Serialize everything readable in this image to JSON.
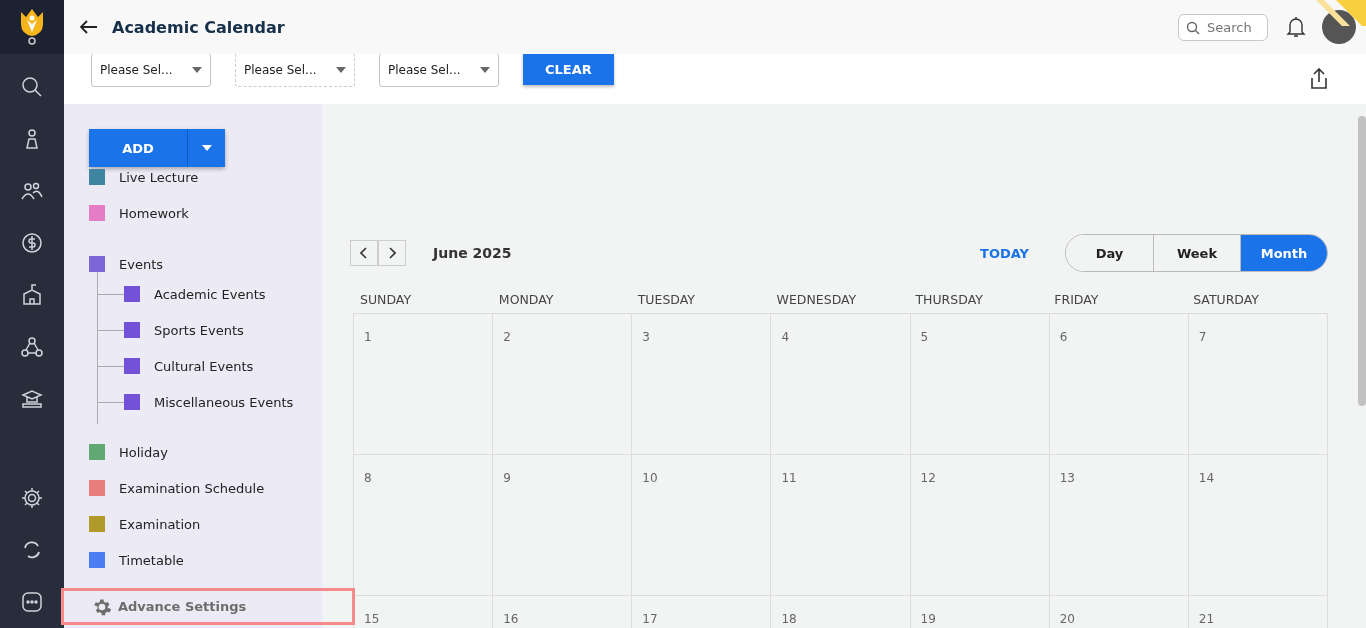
{
  "header": {
    "title": "Academic Calendar",
    "search": {
      "placeholder": "Search"
    }
  },
  "filters": [
    {
      "value": "Please Sel...",
      "disabled": false
    },
    {
      "value": "Please Sel...",
      "disabled": true
    },
    {
      "value": "Please Sel...",
      "disabled": false
    }
  ],
  "clear_button": "CLEAR",
  "add_button": "ADD",
  "legend": [
    {
      "label": "Live Lecture",
      "color": "#3f84a0"
    },
    {
      "label": "Homework",
      "color": "#e47dc6"
    },
    {
      "label": "Events",
      "color": "#7b67d6",
      "children": [
        {
          "label": "Academic Events",
          "color": "#7452d8"
        },
        {
          "label": "Sports Events",
          "color": "#7452d8"
        },
        {
          "label": "Cultural Events",
          "color": "#7452d8"
        },
        {
          "label": "Miscellaneous Events",
          "color": "#7452d8"
        }
      ]
    },
    {
      "label": "Holiday",
      "color": "#61a874"
    },
    {
      "label": "Examination Schedule",
      "color": "#e87e7b"
    },
    {
      "label": "Examination",
      "color": "#b09b2a"
    },
    {
      "label": "Timetable",
      "color": "#4a7cf2"
    }
  ],
  "advance_settings": {
    "label": "Advance Settings",
    "highlighted": true
  },
  "calendar": {
    "month": "June 2025",
    "today": "TODAY",
    "views": [
      {
        "label": "Day",
        "selected": false
      },
      {
        "label": "Week",
        "selected": false
      },
      {
        "label": "Month",
        "selected": true
      }
    ],
    "weekdays": [
      "SUNDAY",
      "MONDAY",
      "TUESDAY",
      "WEDNESDAY",
      "THURSDAY",
      "FRIDAY",
      "SATURDAY"
    ],
    "weeks": [
      [
        "1",
        "2",
        "3",
        "4",
        "5",
        "6",
        "7"
      ],
      [
        "8",
        "9",
        "10",
        "11",
        "12",
        "13",
        "14"
      ],
      [
        "15",
        "16",
        "17",
        "18",
        "19",
        "20",
        "21"
      ]
    ]
  }
}
